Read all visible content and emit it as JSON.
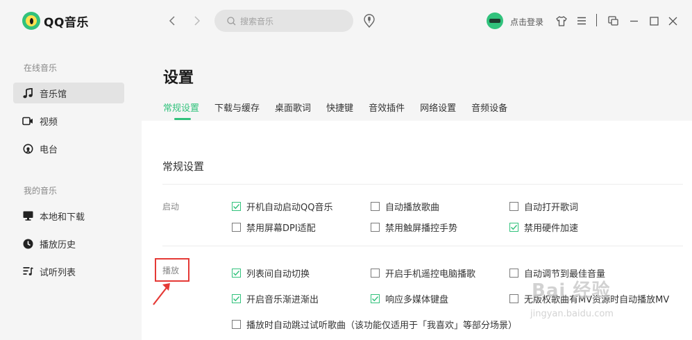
{
  "app": {
    "name": "QQ音乐"
  },
  "sidebar": {
    "online_title": "在线音乐",
    "online_items": [
      {
        "label": "音乐馆",
        "icon": "music-note-icon",
        "active": true
      },
      {
        "label": "视频",
        "icon": "video-icon"
      },
      {
        "label": "电台",
        "icon": "radio-icon"
      }
    ],
    "my_title": "我的音乐",
    "my_items": [
      {
        "label": "本地和下载",
        "icon": "monitor-icon"
      },
      {
        "label": "播放历史",
        "icon": "clock-icon"
      },
      {
        "label": "试听列表",
        "icon": "playlist-icon"
      }
    ]
  },
  "topbar": {
    "search_placeholder": "搜索音乐",
    "login_label": "点击登录"
  },
  "settings": {
    "title": "设置",
    "tabs": [
      "常规设置",
      "下载与缓存",
      "桌面歌词",
      "快捷键",
      "音效插件",
      "网络设置",
      "音频设备"
    ],
    "active_tab": "常规设置",
    "section_title": "常规设置",
    "groups": [
      {
        "label": "启动",
        "options": [
          {
            "label": "开机自动启动QQ音乐",
            "checked": true
          },
          {
            "label": "自动播放歌曲",
            "checked": false
          },
          {
            "label": "自动打开歌词",
            "checked": false
          },
          {
            "label": "禁用屏幕DPI适配",
            "checked": false
          },
          {
            "label": "禁用触屏播控手势",
            "checked": false
          },
          {
            "label": "禁用硬件加速",
            "checked": true
          }
        ]
      },
      {
        "label": "播放",
        "options": [
          {
            "label": "列表间自动切换",
            "checked": true
          },
          {
            "label": "开启手机遥控电脑播歌",
            "checked": false
          },
          {
            "label": "自动调节到最佳音量",
            "checked": false
          },
          {
            "label": "开启音乐渐进渐出",
            "checked": true
          },
          {
            "label": "响应多媒体键盘",
            "checked": true
          },
          {
            "label": "无版权歌曲有MV资源时自动播放MV",
            "checked": false
          },
          {
            "label": "播放时自动跳过试听歌曲（该功能仅适用于「我喜欢」等部分场景）",
            "checked": false
          }
        ]
      }
    ]
  },
  "watermark": {
    "text": "Bai 经验",
    "sub": "jingyan.baidu.com"
  },
  "colors": {
    "accent": "#31c27c",
    "highlight": "#e53935",
    "sidebar_bg": "#f5f5f5"
  }
}
